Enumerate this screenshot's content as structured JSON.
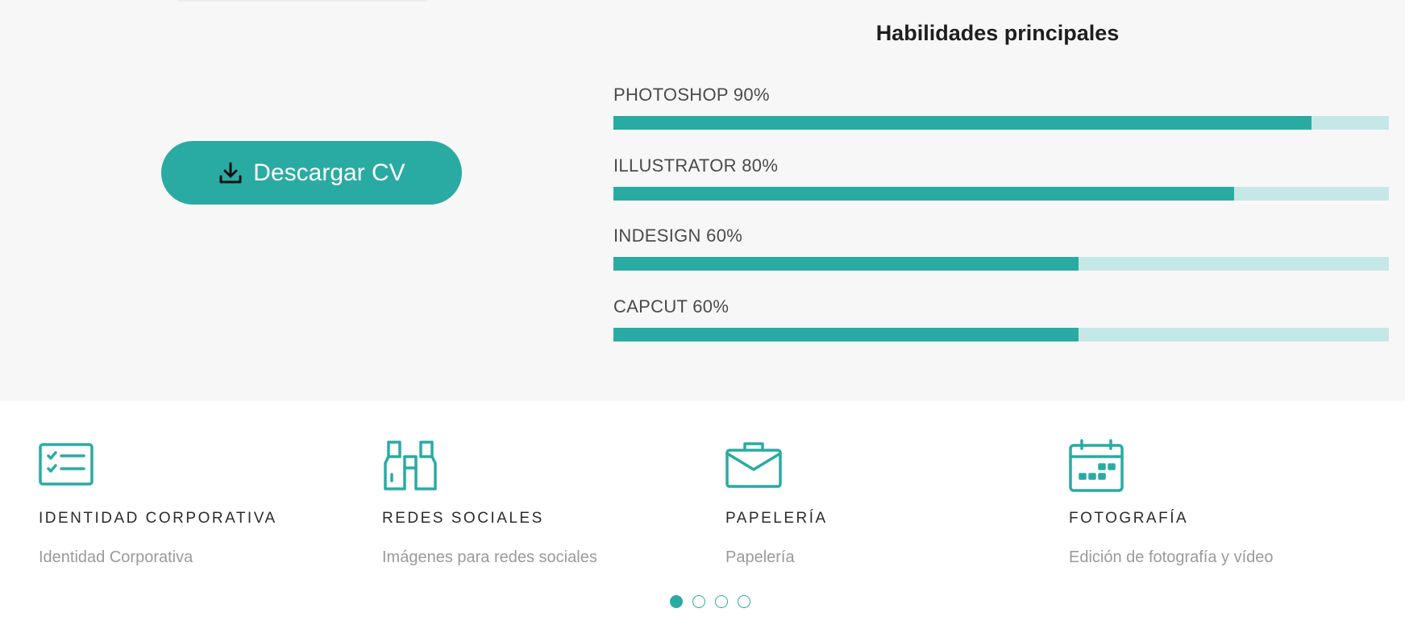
{
  "download": {
    "label": "Descargar CV",
    "icon": "download-icon"
  },
  "skills": {
    "title": "Habilidades principales",
    "items": [
      {
        "label": "PHOTOSHOP 90%",
        "percent": 90
      },
      {
        "label": "ILLUSTRATOR 80%",
        "percent": 80
      },
      {
        "label": "INDESIGN 60%",
        "percent": 60
      },
      {
        "label": "CAPCUT 60%",
        "percent": 60
      }
    ],
    "fill_color": "#29aba4",
    "track_color": "#c5e8e7"
  },
  "services": [
    {
      "icon": "checklist-icon",
      "title": "IDENTIDAD CORPORATIVA",
      "desc": "Identidad Corporativa"
    },
    {
      "icon": "binoculars-icon",
      "title": "REDES SOCIALES",
      "desc": "Imágenes para redes sociales"
    },
    {
      "icon": "briefcase-icon",
      "title": "PAPELERÍA",
      "desc": "Papelería"
    },
    {
      "icon": "calendar-icon",
      "title": "FOTOGRAFÍA",
      "desc": "Edición de fotografía y vídeo"
    }
  ],
  "carousel": {
    "count": 4,
    "active": 0
  },
  "accent": "#29aba4"
}
